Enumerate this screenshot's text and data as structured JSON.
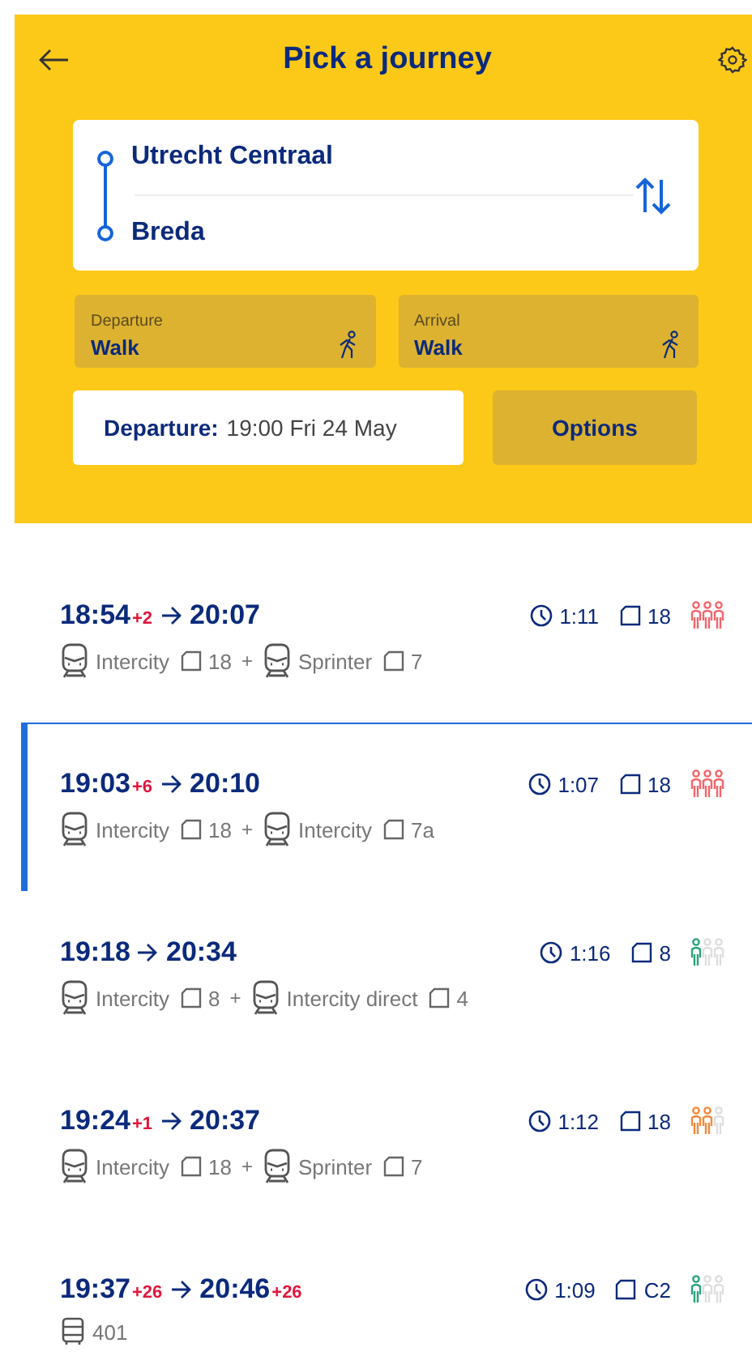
{
  "header": {
    "title": "Pick a journey",
    "from": "Utrecht Centraal",
    "to": "Breda",
    "departure_mode": {
      "label": "Departure",
      "value": "Walk"
    },
    "arrival_mode": {
      "label": "Arrival",
      "value": "Walk"
    },
    "time": {
      "label": "Departure:",
      "value": "19:00 Fri 24 May"
    },
    "options_button": "Options"
  },
  "journeys": [
    {
      "departure": "18:54",
      "departure_delay": "+2",
      "arrival": "20:07",
      "duration": "1:11",
      "platform": "18",
      "crowding": {
        "kind": "busy",
        "color": "#f2666c"
      },
      "selected": false,
      "legs": [
        {
          "kind": "train",
          "name": "Intercity",
          "platform": "18"
        },
        {
          "kind": "train",
          "joiner": "+",
          "name": "Sprinter",
          "platform": "7"
        }
      ]
    },
    {
      "departure": "19:03",
      "departure_delay": "+6",
      "arrival": "20:10",
      "duration": "1:07",
      "platform": "18",
      "crowding": {
        "kind": "busy",
        "color": "#f2666c"
      },
      "selected": true,
      "legs": [
        {
          "kind": "train",
          "name": "Intercity",
          "platform": "18"
        },
        {
          "kind": "train",
          "joiner": "+",
          "name": "Intercity",
          "platform": "7a"
        }
      ]
    },
    {
      "departure": "19:18",
      "arrival": "20:34",
      "duration": "1:16",
      "platform": "8",
      "crowding": {
        "kind": "quiet",
        "color": "#2aa37a"
      },
      "selected": false,
      "legs": [
        {
          "kind": "train",
          "name": "Intercity",
          "platform": "8"
        },
        {
          "kind": "train",
          "joiner": "+",
          "name": "Intercity direct",
          "platform": "4"
        }
      ]
    },
    {
      "departure": "19:24",
      "departure_delay": "+1",
      "arrival": "20:37",
      "duration": "1:12",
      "platform": "18",
      "crowding": {
        "kind": "moderate",
        "color": "#f5893a"
      },
      "selected": false,
      "legs": [
        {
          "kind": "train",
          "name": "Intercity",
          "platform": "18"
        },
        {
          "kind": "train",
          "joiner": "+",
          "name": "Sprinter",
          "platform": "7"
        }
      ]
    },
    {
      "departure": "19:37",
      "departure_delay": "+26",
      "arrival": "20:46",
      "arrival_delay": "+26",
      "duration": "1:09",
      "platform": "C2",
      "crowding": {
        "kind": "quiet",
        "color": "#2aa37a"
      },
      "selected": false,
      "legs": [
        {
          "kind": "bus",
          "name": "401"
        }
      ]
    }
  ]
}
